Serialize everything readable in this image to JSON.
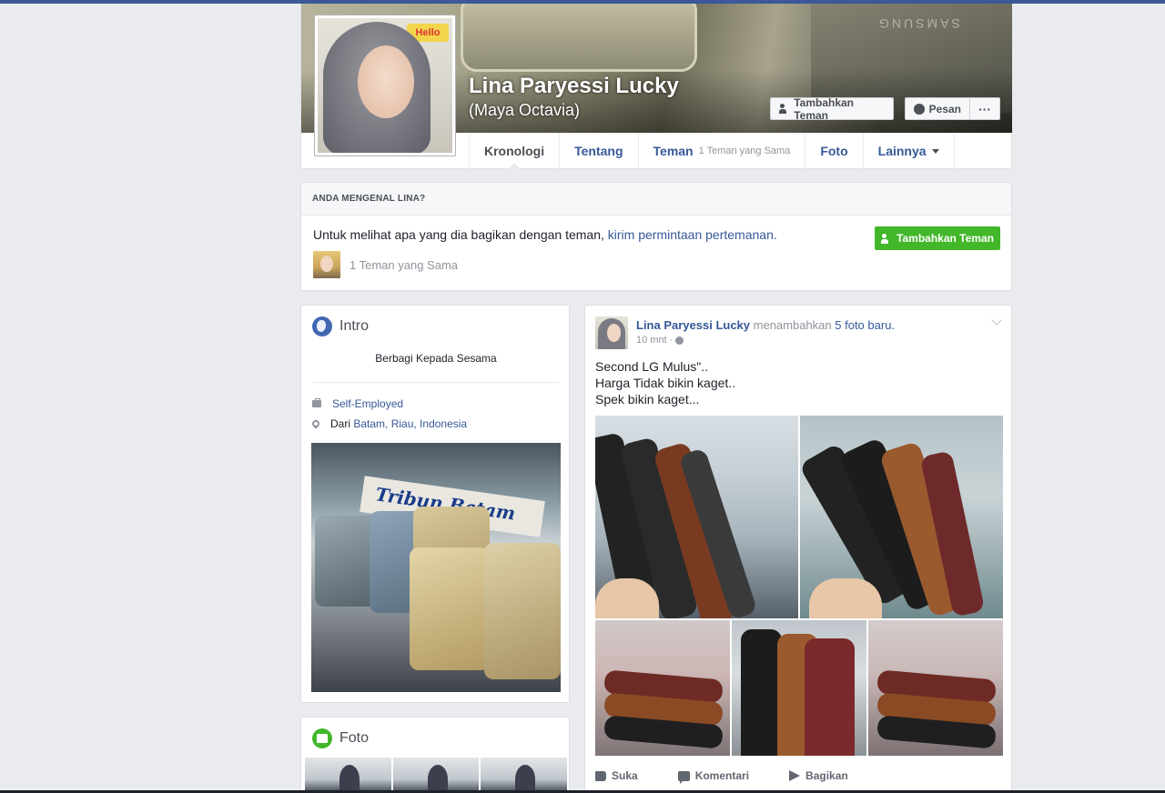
{
  "profile": {
    "name": "Lina Paryessi Lucky",
    "alternate_name": "(Maya Octavia)",
    "add_friend_label": "Tambahkan Teman",
    "message_label": "Pesan",
    "more_label": "···"
  },
  "tabs": [
    {
      "label": "Kronologi"
    },
    {
      "label": "Tentang"
    },
    {
      "label": "Teman",
      "sub": "1 Teman yang Sama"
    },
    {
      "label": "Foto"
    },
    {
      "label": "Lainnya"
    }
  ],
  "know_box": {
    "heading": "ANDA MENGENAL LINA?",
    "text": "Untuk melihat apa yang dia bagikan dengan teman, ",
    "link": "kirim permintaan pertemanan.",
    "button": "Tambahkan Teman",
    "mutual": "1 Teman yang Sama"
  },
  "intro": {
    "title": "Intro",
    "bio": "Berbagi Kepada Sesama",
    "work": "Self-Employed",
    "from_prefix": "Dari",
    "from_place": "Batam, Riau, Indonesia",
    "photo_caption": "Tribun Batam"
  },
  "foto": {
    "title": "Foto"
  },
  "post": {
    "author": "Lina Paryessi Lucky",
    "action": "menambahkan",
    "action_link": "5 foto baru.",
    "time": "10 mnt ·",
    "lines": [
      "Second LG Mulus\"..",
      "Harga Tidak bikin kaget..",
      "Spek bikin kaget..."
    ],
    "like": "Suka",
    "comment": "Komentari",
    "share": "Bagikan"
  },
  "colors": {
    "fb_blue": "#3b5998",
    "link": "#365899",
    "green": "#42b72a",
    "background": "#e9ebee"
  }
}
